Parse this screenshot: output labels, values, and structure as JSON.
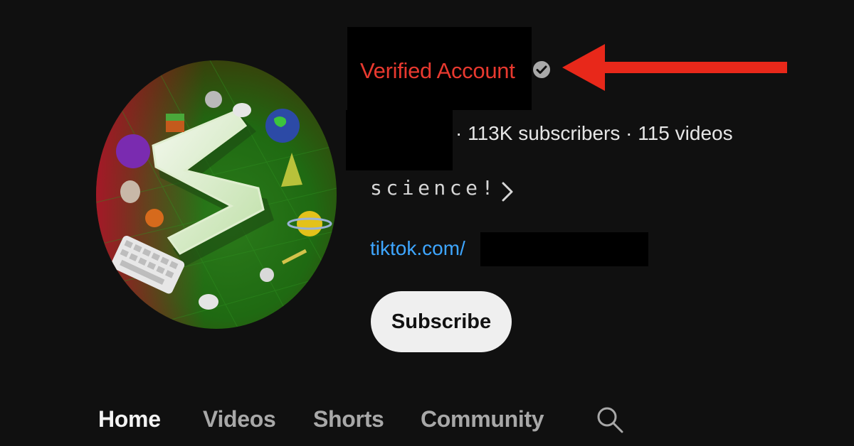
{
  "channel": {
    "annotation_label": "Verified Account",
    "stats": "· 113K subscribers · 115 videos",
    "description": "science!",
    "link_text": "tiktok.com/ ",
    "icons": {
      "verified": "verified-check-icon",
      "description_more": "chevron-right-icon",
      "annotation": "arrow-left-icon",
      "search": "search-icon"
    }
  },
  "actions": {
    "subscribe_label": "Subscribe"
  },
  "tabs": [
    {
      "label": "Home",
      "active": true
    },
    {
      "label": "Videos",
      "active": false
    },
    {
      "label": "Shorts",
      "active": false
    },
    {
      "label": "Community",
      "active": false
    }
  ],
  "colors": {
    "background": "#101010",
    "annotation_red": "#e8392f",
    "link_blue": "#3ea6ff",
    "subscribe_bg": "#efefef"
  }
}
